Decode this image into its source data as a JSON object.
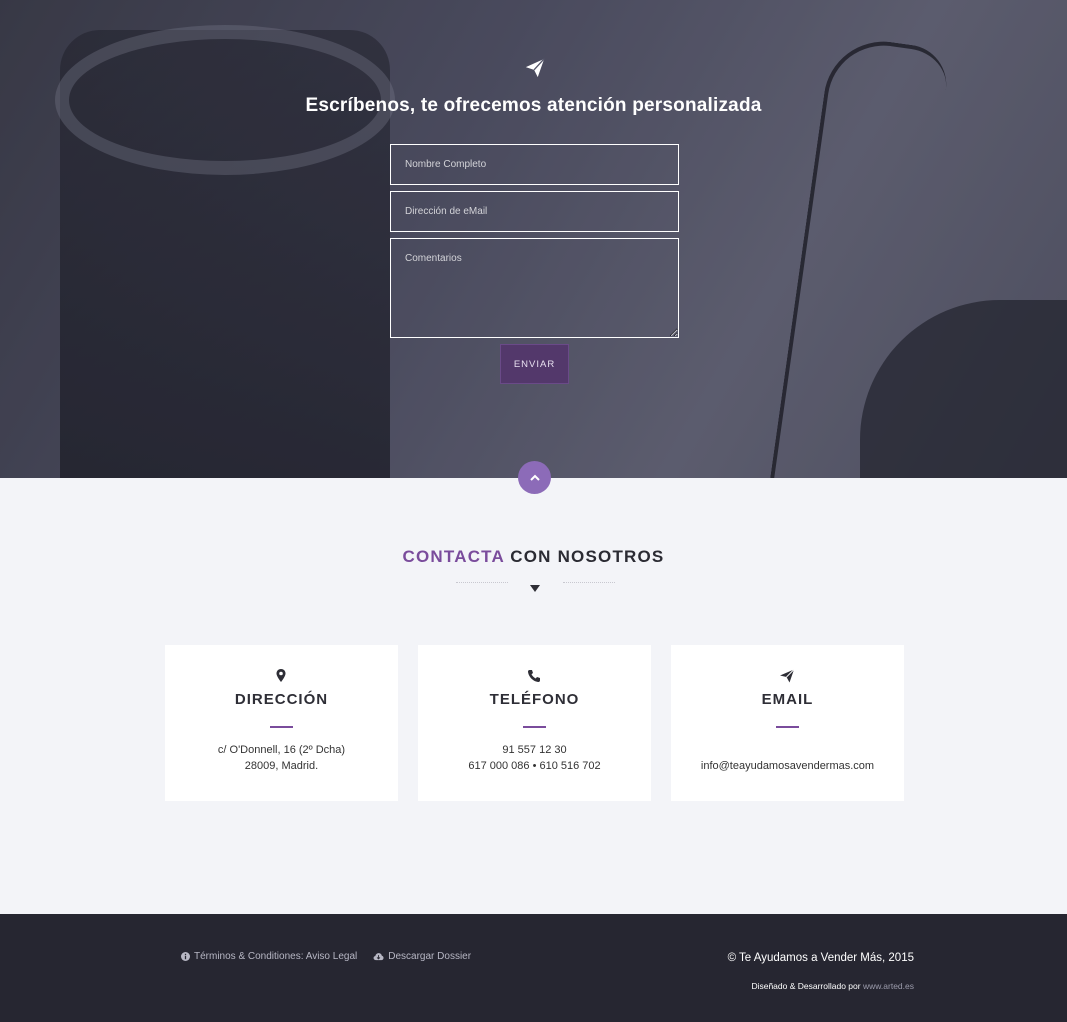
{
  "hero": {
    "title": "Escríbenos, te ofrecemos atención personalizada",
    "form": {
      "name_placeholder": "Nombre Completo",
      "email_placeholder": "Dirección de eMail",
      "comments_placeholder": "Comentarios",
      "submit_label": "ENVIAR"
    },
    "icon": "paper-plane-icon"
  },
  "contact": {
    "title_accent": "CONTACTA",
    "title_rest": " CON NOSOTROS",
    "cards": [
      {
        "icon": "map-marker-icon",
        "title": "DIRECCIÓN",
        "line1": "c/ O'Donnell, 16 (2º Dcha)",
        "line2": "28009, Madrid."
      },
      {
        "icon": "phone-icon",
        "title": "TELÉFONO",
        "line1": "91 557 12 30",
        "line2": "617 000 086  •  610 516 702"
      },
      {
        "icon": "paper-plane-icon",
        "title": "EMAIL",
        "line1": "",
        "line2": "info@teayudamosavendermas.com"
      }
    ]
  },
  "footer": {
    "link_terms": "Términos & Conditiones: Aviso Legal",
    "link_dossier": "Descargar Dossier",
    "copyright": "© Te Ayudamos a Vender Más, 2015",
    "credits_prefix": "Diseñado & Desarrollado por ",
    "credits_site": "www.arted.es"
  },
  "colors": {
    "accent": "#7a4c9c",
    "button": "#53386b",
    "scroll_button": "#8c6bb8",
    "footer_bg": "#262631"
  }
}
